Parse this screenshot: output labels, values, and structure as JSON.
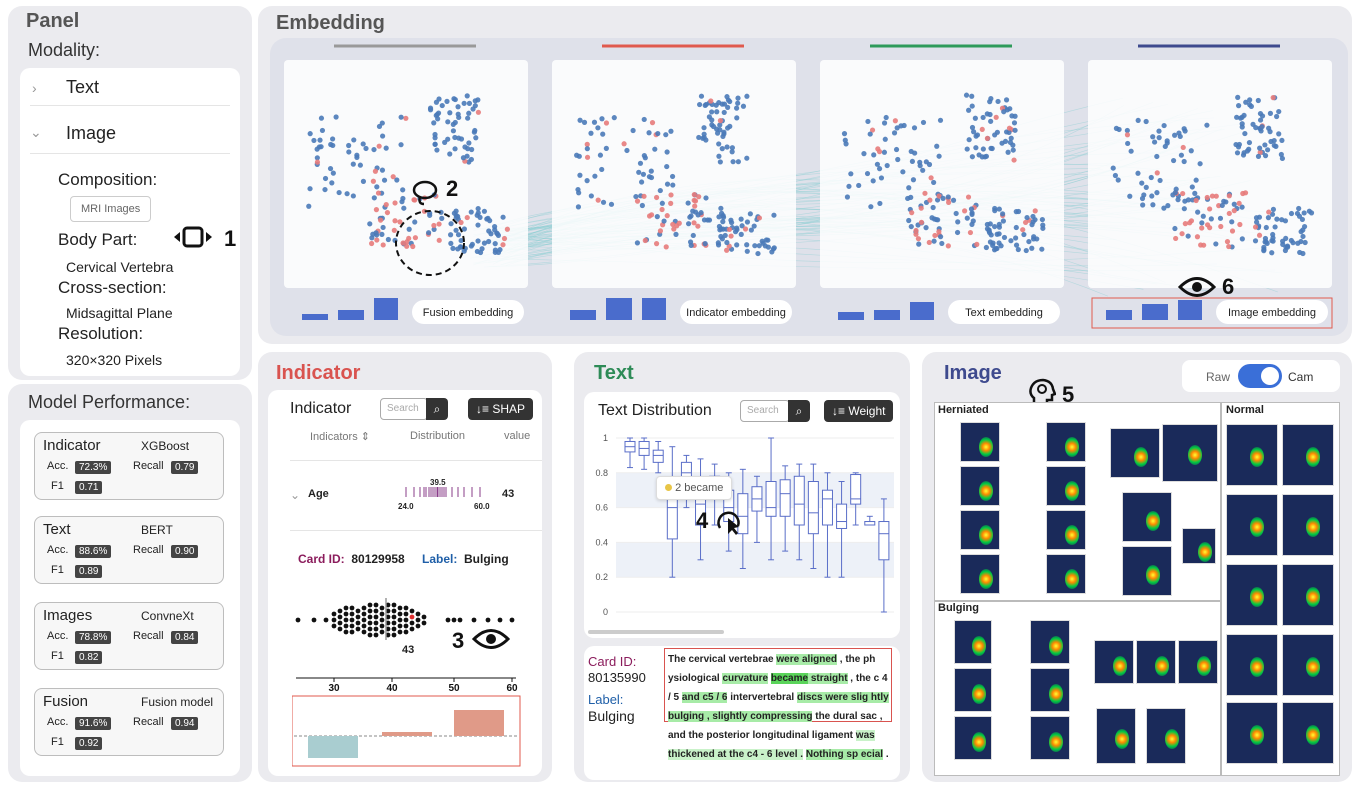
{
  "panel": {
    "title": "Panel",
    "modality_heading": "Modality:",
    "items": [
      {
        "label": "Text",
        "chevron": "chevron-right"
      },
      {
        "label": "Image",
        "chevron": "chevron-down"
      }
    ],
    "composition_label": "Composition:",
    "composition_value": "MRI Images",
    "body_part_label": "Body Part:",
    "body_part_value": "Cervical Vertebra",
    "cross_section_label": "Cross-section:",
    "cross_section_value": "Midsagittal Plane",
    "resolution_label": "Resolution:",
    "resolution_value": "320×320 Pixels",
    "annotation_1": "1"
  },
  "performance": {
    "title": "Model Performance:",
    "cards": [
      {
        "name": "Indicator",
        "model": "XGBoost",
        "acc_label": "Acc.",
        "acc": "72.3%",
        "recall_label": "Recall",
        "recall": "0.79",
        "f1_label": "F1",
        "f1": "0.71"
      },
      {
        "name": "Text",
        "model": "BERT",
        "acc_label": "Acc.",
        "acc": "88.6%",
        "recall_label": "Recall",
        "recall": "0.90",
        "f1_label": "F1",
        "f1": "0.89"
      },
      {
        "name": "Images",
        "model": "ConvneXt",
        "acc_label": "Acc.",
        "acc": "78.8%",
        "recall_label": "Recall",
        "recall": "0.84",
        "f1_label": "F1",
        "f1": "0.82"
      },
      {
        "name": "Fusion",
        "model": "Fusion model",
        "acc_label": "Acc.",
        "acc": "91.6%",
        "recall_label": "Recall",
        "recall": "0.94",
        "f1_label": "F1",
        "f1": "0.92"
      }
    ]
  },
  "embedding": {
    "title": "Embedding",
    "views": [
      {
        "label": "Fusion embedding",
        "color": "#999999"
      },
      {
        "label": "Indicator embedding",
        "color": "#e05a4e"
      },
      {
        "label": "Text embedding",
        "color": "#2e9a5a"
      },
      {
        "label": "Image embedding",
        "color": "#3e4a8e"
      }
    ],
    "annotation_2": "2",
    "annotation_6": "6"
  },
  "indicator": {
    "section_title": "Indicator",
    "card_title": "Indicator",
    "search_placeholder": "Search",
    "sort_button": "SHAP",
    "col_indicators": "Indicators",
    "col_distribution": "Distribution",
    "col_value": "value",
    "row_name": "Age",
    "row_median": "39.5",
    "row_min": "24.0",
    "row_max": "60.0",
    "row_value": "43",
    "card_id_label": "Card ID:",
    "card_id": "80129958",
    "label_label": "Label:",
    "label_value": "Bulging",
    "beeswarm_value": "43",
    "axis_ticks": [
      "30",
      "40",
      "50",
      "60"
    ],
    "annotation_3": "3"
  },
  "text": {
    "section_title": "Text",
    "card_title": "Text Distribution",
    "search_placeholder": "Search",
    "sort_button": "Weight",
    "y_ticks": [
      "1",
      "0.8",
      "0.6",
      "0.4",
      "0.2",
      "0"
    ],
    "tooltip": "2 became",
    "annotation_4": "4",
    "card_id_label": "Card ID:",
    "card_id": "80135990",
    "label_label": "Label:",
    "label_value": "Bulging"
  },
  "image": {
    "section_title": "Image",
    "toggle_raw": "Raw",
    "toggle_cam": "Cam",
    "annotation_5": "5",
    "groups": [
      "Herniated",
      "Normal",
      "Bulging"
    ]
  },
  "chart_data": {
    "type": "box",
    "y_ticks": [
      0,
      0.2,
      0.4,
      0.6,
      0.8,
      1
    ],
    "ylim": [
      0,
      1
    ],
    "boxes": [
      {
        "min": 0.83,
        "q1": 0.92,
        "median": 0.95,
        "q3": 0.98,
        "max": 1.0
      },
      {
        "min": 0.82,
        "q1": 0.9,
        "median": 0.94,
        "q3": 0.98,
        "max": 1.0
      },
      {
        "min": 0.8,
        "q1": 0.86,
        "median": 0.9,
        "q3": 0.93,
        "max": 0.98
      },
      {
        "min": 0.2,
        "q1": 0.42,
        "median": 0.6,
        "q3": 0.75,
        "max": 0.95
      },
      {
        "min": 0.6,
        "q1": 0.72,
        "median": 0.8,
        "q3": 0.86,
        "max": 0.9
      },
      {
        "min": 0.3,
        "q1": 0.5,
        "median": 0.62,
        "q3": 0.72,
        "max": 0.88
      },
      {
        "min": 0.5,
        "q1": 0.65,
        "median": 0.7,
        "q3": 0.78,
        "max": 0.85
      },
      {
        "min": 0.35,
        "q1": 0.52,
        "median": 0.6,
        "q3": 0.7,
        "max": 0.8
      },
      {
        "min": 0.25,
        "q1": 0.45,
        "median": 0.55,
        "q3": 0.68,
        "max": 0.82
      },
      {
        "min": 0.4,
        "q1": 0.58,
        "median": 0.65,
        "q3": 0.72,
        "max": 0.78
      },
      {
        "min": 0.3,
        "q1": 0.55,
        "median": 0.6,
        "q3": 0.75,
        "max": 1.0
      },
      {
        "min": 0.35,
        "q1": 0.55,
        "median": 0.68,
        "q3": 0.76,
        "max": 0.84
      },
      {
        "min": 0.3,
        "q1": 0.5,
        "median": 0.62,
        "q3": 0.78,
        "max": 0.85
      },
      {
        "min": 0.25,
        "q1": 0.45,
        "median": 0.57,
        "q3": 0.75,
        "max": 0.85
      },
      {
        "min": 0.2,
        "q1": 0.5,
        "median": 0.65,
        "q3": 0.7,
        "max": 0.8
      },
      {
        "min": 0.2,
        "q1": 0.48,
        "median": 0.52,
        "q3": 0.62,
        "max": 0.75
      },
      {
        "min": 0.5,
        "q1": 0.62,
        "median": 0.65,
        "q3": 0.79,
        "max": 0.8
      },
      {
        "min": 0.5,
        "q1": 0.5,
        "median": 0.52,
        "q3": 0.52,
        "max": 0.55
      },
      {
        "min": 0.0,
        "q1": 0.3,
        "median": 0.45,
        "q3": 0.52,
        "max": 0.65
      }
    ]
  },
  "text_report": [
    {
      "t": "The cervical vertebrae ",
      "h": ""
    },
    {
      "t": "were aligned",
      "h": "hl1"
    },
    {
      "t": " , the ph ysiological ",
      "h": ""
    },
    {
      "t": "curvature",
      "h": "hl1"
    },
    {
      "t": " ",
      "h": ""
    },
    {
      "t": "became",
      "h": "hl2"
    },
    {
      "t": " straight",
      "h": "hl1"
    },
    {
      "t": " , the c 4 / 5 ",
      "h": ""
    },
    {
      "t": "and c5 / 6",
      "h": "hl1"
    },
    {
      "t": " intervertebral ",
      "h": ""
    },
    {
      "t": "discs were slig htly bulging , slightly compressing",
      "h": "hl1"
    },
    {
      "t": " the dural sac , and the posterior longitudinal ligament ",
      "h": ""
    },
    {
      "t": "was thickened at the c4 - 6 level .",
      "h": "hl3"
    },
    {
      "t": " ",
      "h": ""
    },
    {
      "t": "Nothing sp ecial",
      "h": "hl1"
    },
    {
      "t": " .",
      "h": ""
    }
  ]
}
